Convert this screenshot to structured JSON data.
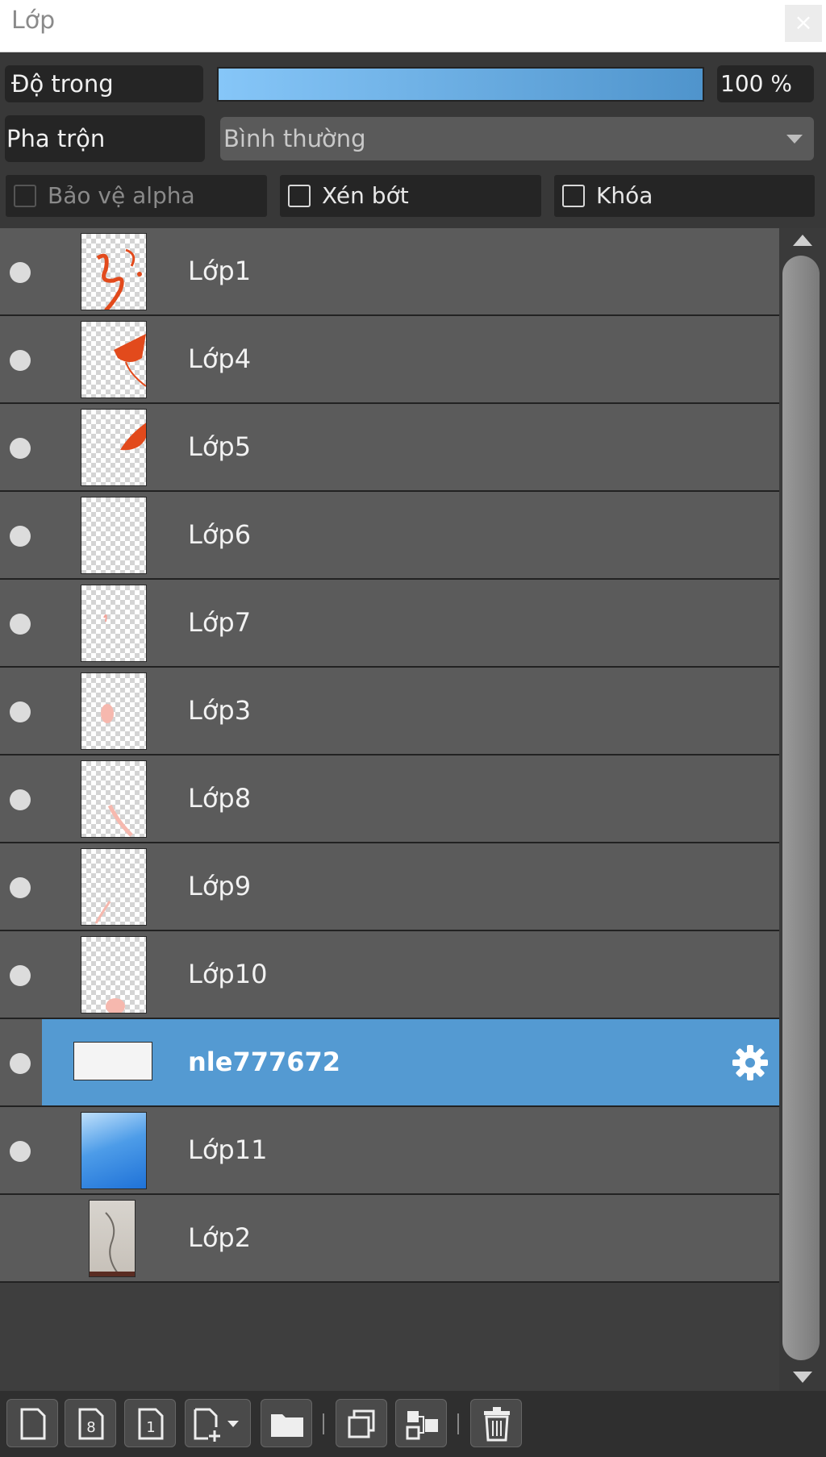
{
  "panel": {
    "title": "Lớp",
    "close_icon": "close-icon"
  },
  "properties": {
    "opacity_label": "Độ trong",
    "opacity_value": "100 %",
    "opacity_fraction": 1.0,
    "blend_label": "Pha trộn",
    "blend_value": "Bình thường",
    "protect_alpha_label": "Bảo vệ alpha",
    "clip_label": "Xén bớt",
    "lock_label": "Khóa"
  },
  "layers": [
    {
      "name": "Lớp1",
      "visible": true
    },
    {
      "name": "Lớp4",
      "visible": true
    },
    {
      "name": "Lớp5",
      "visible": true
    },
    {
      "name": "Lớp6",
      "visible": true
    },
    {
      "name": "Lớp7",
      "visible": true
    },
    {
      "name": "Lớp3",
      "visible": true
    },
    {
      "name": "Lớp8",
      "visible": true
    },
    {
      "name": "Lớp9",
      "visible": true
    },
    {
      "name": "Lớp10",
      "visible": true
    },
    {
      "name": "nle777672",
      "visible": true,
      "selected": true
    },
    {
      "name": "Lớp11",
      "visible": true
    },
    {
      "name": "Lớp2",
      "visible": false
    }
  ],
  "colors": {
    "selected": "#549ad2",
    "row": "#5b5b5b",
    "accent_opacity_start": "#86c6f8",
    "accent_opacity_end": "#4f94cc"
  },
  "toolbar_icons": [
    "new-layer-icon",
    "new-8bit-layer-icon",
    "new-1bit-layer-icon",
    "add-layer-menu-icon",
    "new-folder-icon",
    "duplicate-layer-icon",
    "merge-layer-icon",
    "delete-layer-icon"
  ]
}
